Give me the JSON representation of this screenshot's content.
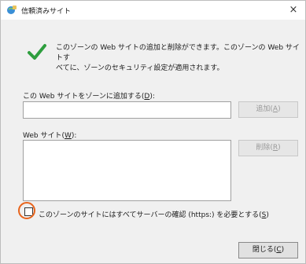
{
  "window": {
    "title": "信頼済みサイト",
    "close_label": "×"
  },
  "info": {
    "description": "このゾーンの Web サイトの追加と削除ができます。このゾーンの Web サイトす\nべてに、ゾーンのセキュリティ設定が適用されます。"
  },
  "add_site": {
    "label_prefix": "この Web サイトをゾーンに追加する(",
    "label_key": "D",
    "label_suffix": "):",
    "input_value": "",
    "button_prefix": "追加(",
    "button_key": "A",
    "button_suffix": ")"
  },
  "sites": {
    "label_prefix": "Web サイト(",
    "label_key": "W",
    "label_suffix": "):",
    "items": [],
    "remove_prefix": "削除(",
    "remove_key": "R",
    "remove_suffix": ")"
  },
  "https_check": {
    "label_prefix": "このゾーンのサイトにはすべてサーバーの確認 (https:) を必要とする(",
    "label_key": "S",
    "label_suffix": ")",
    "checked": false
  },
  "footer": {
    "close_prefix": "閉じる(",
    "close_key": "C",
    "close_suffix": ")"
  },
  "colors": {
    "accent_highlight": "#e8641c",
    "check_green": "#2e9e3e"
  }
}
